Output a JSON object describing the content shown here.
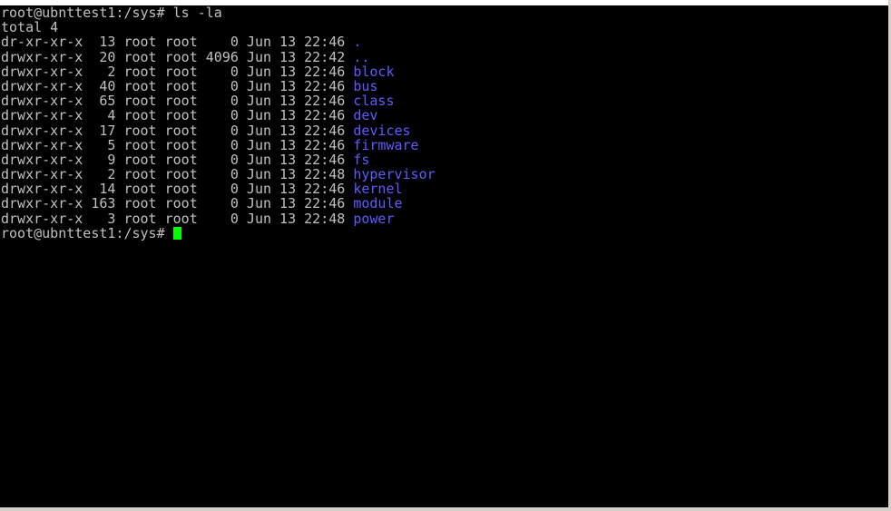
{
  "terminal": {
    "command_line": {
      "prompt": "root@ubnttest1:/sys# ",
      "command": "ls -la"
    },
    "total_line": "total 4",
    "entries": [
      {
        "meta": "dr-xr-xr-x  13 root root    0 Jun 13 22:46 ",
        "name": "."
      },
      {
        "meta": "drwxr-xr-x  20 root root 4096 Jun 13 22:42 ",
        "name": ".."
      },
      {
        "meta": "drwxr-xr-x   2 root root    0 Jun 13 22:46 ",
        "name": "block"
      },
      {
        "meta": "drwxr-xr-x  40 root root    0 Jun 13 22:46 ",
        "name": "bus"
      },
      {
        "meta": "drwxr-xr-x  65 root root    0 Jun 13 22:46 ",
        "name": "class"
      },
      {
        "meta": "drwxr-xr-x   4 root root    0 Jun 13 22:46 ",
        "name": "dev"
      },
      {
        "meta": "drwxr-xr-x  17 root root    0 Jun 13 22:46 ",
        "name": "devices"
      },
      {
        "meta": "drwxr-xr-x   5 root root    0 Jun 13 22:46 ",
        "name": "firmware"
      },
      {
        "meta": "drwxr-xr-x   9 root root    0 Jun 13 22:46 ",
        "name": "fs"
      },
      {
        "meta": "drwxr-xr-x   2 root root    0 Jun 13 22:48 ",
        "name": "hypervisor"
      },
      {
        "meta": "drwxr-xr-x  14 root root    0 Jun 13 22:46 ",
        "name": "kernel"
      },
      {
        "meta": "drwxr-xr-x 163 root root    0 Jun 13 22:46 ",
        "name": "module"
      },
      {
        "meta": "drwxr-xr-x   3 root root    0 Jun 13 22:48 ",
        "name": "power"
      }
    ],
    "current_prompt": "root@ubnttest1:/sys# ",
    "colors": {
      "background": "#000000",
      "text": "#c0c0c0",
      "directory": "#5c5cff",
      "cursor": "#00ff00"
    }
  }
}
